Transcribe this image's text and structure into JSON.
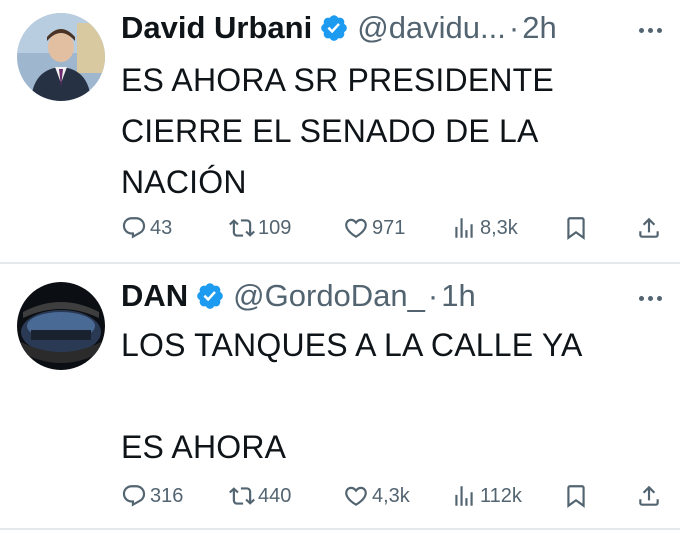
{
  "tweets": [
    {
      "author_name": "David Urbani",
      "handle": "@davidu...",
      "separator": "·",
      "time": "2h",
      "text": "ES AHORA SR PRESIDENTE\nCIERRE EL SENADO DE LA\nNACIÓN",
      "replies": "43",
      "retweets": "109",
      "likes": "971",
      "views": "8,3k"
    },
    {
      "author_name": "DAN",
      "handle": "@GordoDan_",
      "separator": "·",
      "time": "1h",
      "text": "LOS TANQUES A LA CALLE YA\n\nES AHORA",
      "replies": "316",
      "retweets": "440",
      "likes": "4,3k",
      "views": "112k"
    }
  ],
  "icons": {
    "verified": "verified-badge-icon",
    "more": "more-options-icon",
    "reply": "reply-icon",
    "retweet": "retweet-icon",
    "like": "heart-icon",
    "views": "views-icon",
    "bookmark": "bookmark-icon",
    "share": "share-icon"
  },
  "colors": {
    "text": "#0f1419",
    "secondary": "#536471",
    "verified": "#1d9bf0",
    "divider": "#e6e9ec"
  }
}
